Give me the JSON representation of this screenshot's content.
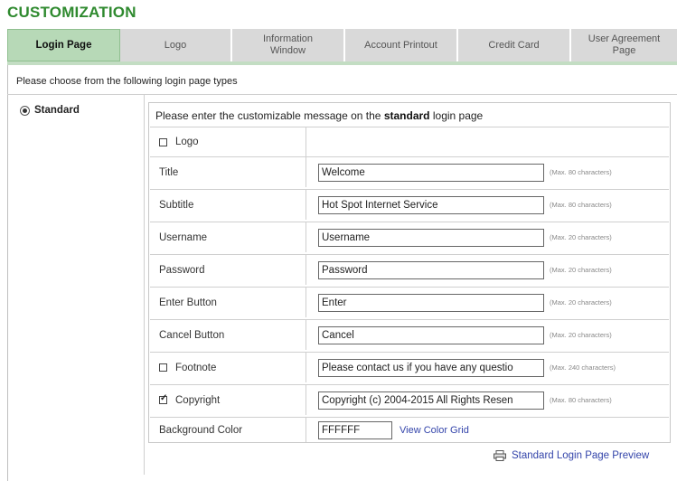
{
  "page_title": "CUSTOMIZATION",
  "tabs": [
    {
      "line1": "Login Page",
      "line2": ""
    },
    {
      "line1": "Logo",
      "line2": ""
    },
    {
      "line1": "Information",
      "line2": "Window"
    },
    {
      "line1": "Account Printout",
      "line2": ""
    },
    {
      "line1": "Credit Card",
      "line2": ""
    },
    {
      "line1": "User Agreement",
      "line2": "Page"
    }
  ],
  "intro": "Please choose from the following login page types",
  "type_option": "Standard",
  "panel_head": {
    "before": "Please enter the customizable message on the ",
    "bold": "standard",
    "after": " login page"
  },
  "fields": {
    "logo": {
      "label": "Logo",
      "checked": false
    },
    "title": {
      "label": "Title",
      "value": "Welcome",
      "hint": "(Max. 80 characters)"
    },
    "subtitle": {
      "label": "Subtitle",
      "value": "Hot Spot Internet Service",
      "hint": "(Max. 80 characters)"
    },
    "username": {
      "label": "Username",
      "value": "Username",
      "hint": "(Max. 20 characters)"
    },
    "password": {
      "label": "Password",
      "value": "Password",
      "hint": "(Max. 20 characters)"
    },
    "enter_button": {
      "label": "Enter Button",
      "value": "Enter",
      "hint": "(Max. 20 characters)"
    },
    "cancel_button": {
      "label": "Cancel Button",
      "value": "Cancel",
      "hint": "(Max. 20 characters)"
    },
    "footnote": {
      "label": "Footnote",
      "checked": false,
      "value": "Please contact us if you have any questio",
      "hint": "(Max. 240 characters)"
    },
    "copyright": {
      "label": "Copyright",
      "checked": true,
      "value": "Copyright (c) 2004-2015 All Rights Resen",
      "hint": "(Max. 80 characters)"
    },
    "background_color": {
      "label": "Background Color",
      "value": "FFFFFF",
      "link": "View Color Grid"
    }
  },
  "preview_link": "Standard Login Page Preview",
  "colors": {
    "title_green": "#2f8a2f",
    "active_tab": "#b7d9b7",
    "link_blue": "#3344aa"
  }
}
